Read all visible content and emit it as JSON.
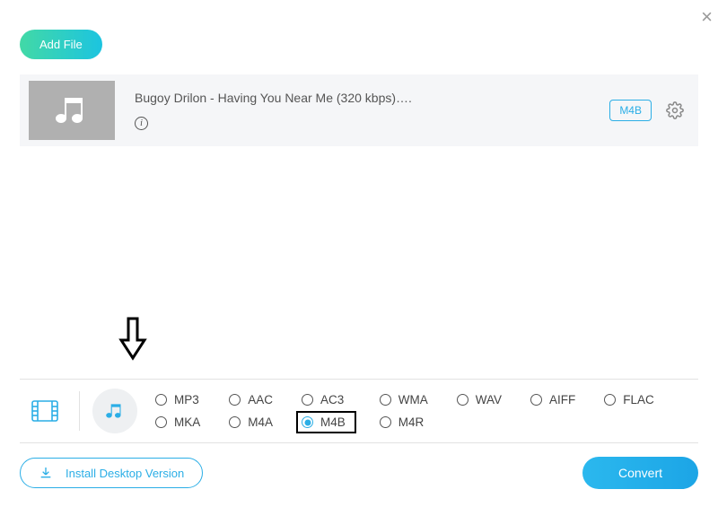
{
  "close_label": "×",
  "add_file_label": "Add File",
  "file": {
    "title": "Bugoy Drilon - Having You Near Me (320 kbps)….",
    "format_badge": "M4B"
  },
  "formats": {
    "row1": [
      "MP3",
      "AAC",
      "AC3",
      "WMA",
      "WAV",
      "AIFF",
      "FLAC"
    ],
    "row2": [
      "MKA",
      "M4A",
      "M4B",
      "M4R"
    ],
    "selected": "M4B"
  },
  "install_label": "Install Desktop Version",
  "convert_label": "Convert"
}
